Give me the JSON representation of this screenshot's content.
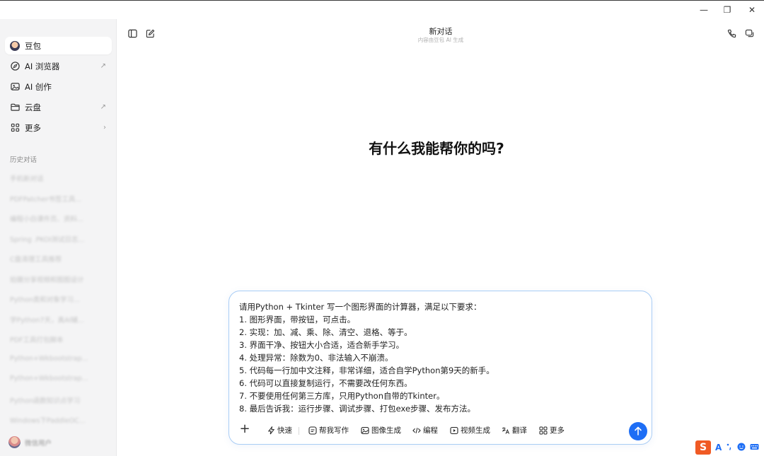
{
  "window": {
    "controls": {
      "minimize": "—",
      "maximize": "❐",
      "close": "✕"
    }
  },
  "sidebar": {
    "items": [
      {
        "label": "豆包",
        "icon": "avatar-icon"
      },
      {
        "label": "AI 浏览器",
        "icon": "compass-icon",
        "trail": "↗"
      },
      {
        "label": "AI 创作",
        "icon": "image-icon"
      },
      {
        "label": "云盘",
        "icon": "folder-icon",
        "trail": "↗"
      },
      {
        "label": "更多",
        "icon": "grid-icon",
        "trail": "›"
      }
    ],
    "history_label": "历史对话",
    "history": [
      "手机新对话",
      "PDFPatcher书签工具...",
      "编程小白课件页、资料...",
      "Spring .PKOI测试日志...",
      "C盘清理工具推荐",
      "拍摄分享视频和图图设计",
      "Python类和对象学习...",
      "学Python7天，真AI辅...",
      "PDF工具打包脚本",
      "Python+Wkbootstrap...",
      "Python+Wkbootstrap...",
      "Python函数知识点学习",
      "Windows下PaddleOC..."
    ],
    "user_name": "微信用户"
  },
  "header": {
    "title": "新对话",
    "subtitle": "内容由豆包 AI 生成"
  },
  "welcome": "有什么我能帮你的吗?",
  "composer": {
    "lines": [
      "请用Python + Tkinter 写一个图形界面的计算器，满足以下要求：",
      "1. 图形界面，带按钮，可点击。",
      "2. 实现：加、减、乘、除、清空、退格、等于。",
      "3. 界面干净、按钮大小合适，适合新手学习。",
      "4. 处理异常：除数为0、非法输入不崩溃。",
      "5. 代码每一行加中文注释，非常详细，适合自学Python第9天的新手。",
      "6. 代码可以直接复制运行，不需要改任何东西。",
      "7. 不要使用任何第三方库，只用Python自带的Tkinter。",
      "8. 最后告诉我：运行步骤、调试步骤、打包exe步骤、发布方法。"
    ],
    "tools": [
      {
        "label": "快速",
        "icon": "bolt-icon"
      },
      {
        "label": "帮我写作",
        "icon": "pen-icon"
      },
      {
        "label": "图像生成",
        "icon": "image-icon"
      },
      {
        "label": "编程",
        "icon": "code-icon"
      },
      {
        "label": "视频生成",
        "icon": "video-icon"
      },
      {
        "label": "翻译",
        "icon": "translate-icon"
      },
      {
        "label": "更多",
        "icon": "grid-icon"
      }
    ],
    "accent": "#1e6ef5"
  },
  "tray": {
    "ime": "S",
    "mode": "A"
  }
}
